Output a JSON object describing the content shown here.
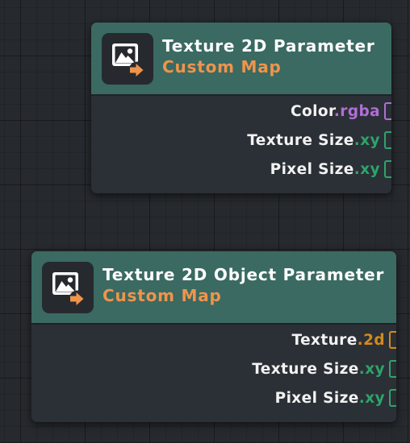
{
  "nodes": [
    {
      "title": "Texture 2D Parameter",
      "subtitle": "Custom Map",
      "icon": "image-input-icon",
      "ports": [
        {
          "name": "Color",
          "type": ".rgba",
          "color": "#b06ed6"
        },
        {
          "name": "Texture Size",
          "type": ".xy",
          "color": "#2ea36b"
        },
        {
          "name": "Pixel Size",
          "type": ".xy",
          "color": "#2ea36b"
        }
      ]
    },
    {
      "title": "Texture 2D Object Parameter",
      "subtitle": "Custom Map",
      "icon": "image-input-icon",
      "ports": [
        {
          "name": "Texture",
          "type": ".2d",
          "color": "#d48a1c"
        },
        {
          "name": "Texture Size",
          "type": ".xy",
          "color": "#2ea36b"
        },
        {
          "name": "Pixel Size",
          "type": ".xy",
          "color": "#2ea36b"
        }
      ]
    }
  ],
  "colors": {
    "header": "#3a6a62",
    "body": "#2b3036",
    "subtitle": "#f0944b",
    "canvas": "#26292e"
  }
}
